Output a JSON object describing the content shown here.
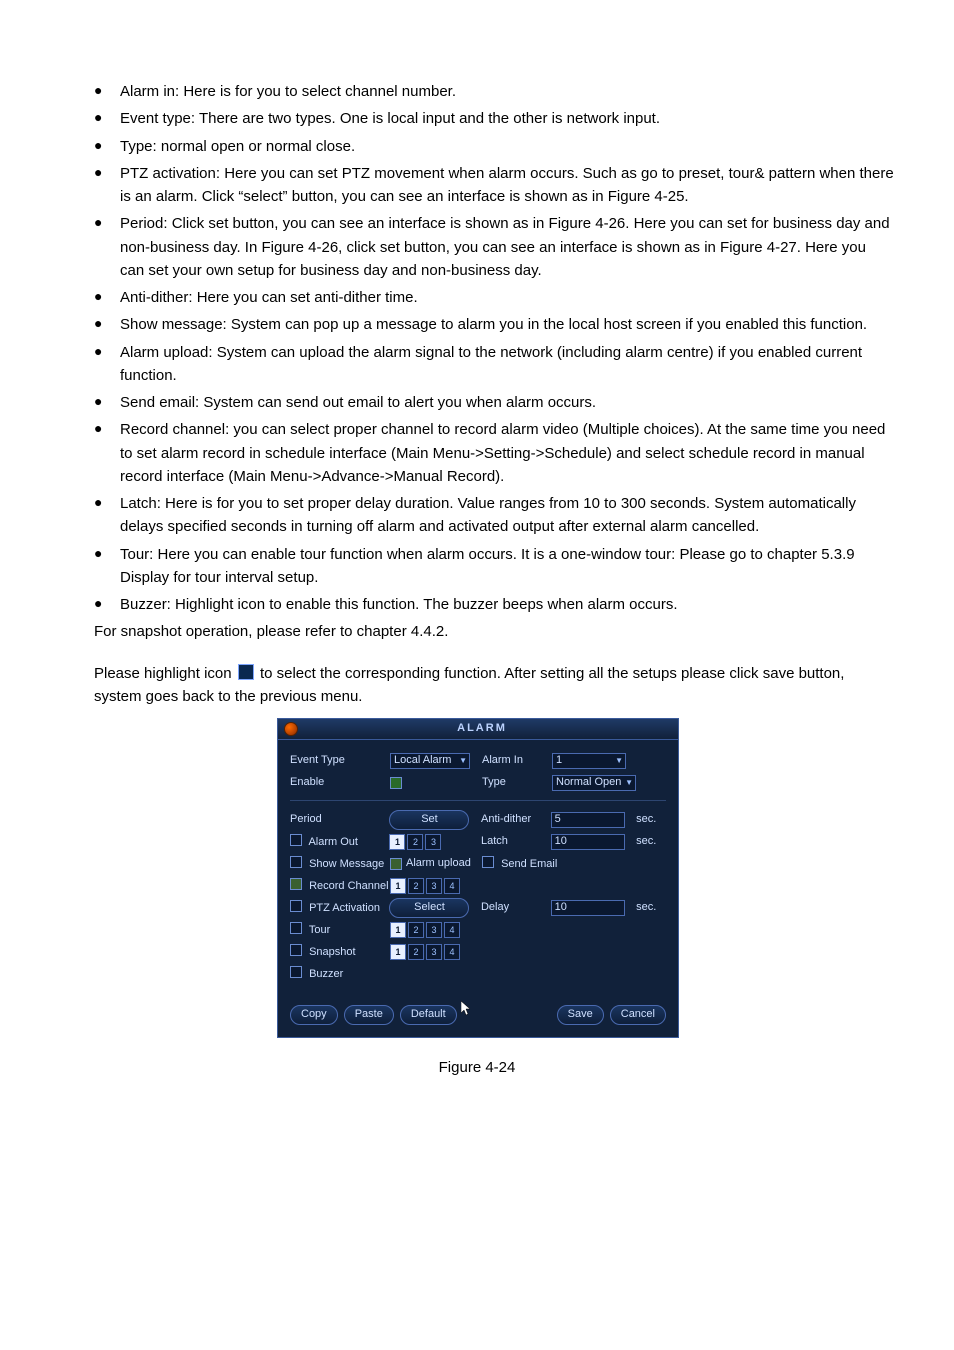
{
  "bullets": [
    "Alarm in: Here is for you to select channel number.",
    "Event type: There are two types. One is local input and the other is network input.",
    "Type: normal open or normal close.",
    "PTZ activation: Here you can set PTZ movement when alarm occurs. Such as go to preset, tour& pattern when there is an alarm. Click “select” button, you can see an interface is shown as in Figure 4-25.",
    "Period: Click set button, you can see an interface is shown as in Figure 4-26. Here you can set for business day and non-business day. In Figure 4-26, click set button, you can see an interface is shown as in Figure 4-27. Here you can set your own setup for business day and non-business day.",
    "Anti-dither: Here you can set anti-dither time.",
    "Show message: System can pop up a message to alarm you in the local host screen if you enabled this function.",
    "Alarm upload: System can upload the alarm signal to the network (including alarm centre) if you enabled current function.",
    "Send email: System can send out email to alert you when alarm occurs.",
    "Record channel: you can select proper channel to record alarm video (Multiple choices). At the same time you need to set alarm record in schedule interface (Main Menu->Setting->Schedule) and select schedule record in manual record interface (Main Menu->Advance->Manual Record).",
    "Latch: Here is for you to set proper delay duration. Value ranges from 10 to 300 seconds. System automatically delays specified seconds in turning off alarm and activated output after external alarm cancelled.",
    "Tour: Here you can enable tour function when alarm occurs.  It is a one-window tour: Please go to chapter 5.3.9 Display for tour interval setup.",
    "Buzzer: Highlight icon to enable this function. The buzzer beeps when alarm occurs."
  ],
  "post_bullets_line": "For snapshot operation, please refer to chapter 4.4.2.",
  "icon_paragraph_before": "Please highlight icon ",
  "icon_paragraph_after": " to select the corresponding function. After setting all the setups please click save button, system goes back to the previous menu.",
  "figure_caption": "Figure 4-24",
  "dvr": {
    "title": "ALARM",
    "labels": {
      "event_type": "Event Type",
      "enable": "Enable",
      "alarm_in": "Alarm In",
      "type": "Type",
      "period": "Period",
      "anti_dither": "Anti-dither",
      "alarm_out": "Alarm Out",
      "latch": "Latch",
      "show_msg": "Show Message",
      "alarm_upload": "Alarm upload",
      "send_email": "Send Email",
      "record_ch": "Record Channel",
      "ptz": "PTZ Activation",
      "delay": "Delay",
      "tour": "Tour",
      "snapshot": "Snapshot",
      "buzzer": "Buzzer",
      "sec": "sec."
    },
    "values": {
      "event_type": "Local Alarm",
      "alarm_in": "1",
      "type": "Normal Open",
      "anti_dither": "5",
      "latch": "10",
      "delay": "10"
    },
    "buttons": {
      "set": "Set",
      "select": "Select",
      "copy": "Copy",
      "paste": "Paste",
      "default": "Default",
      "save": "Save",
      "cancel": "Cancel"
    },
    "alarm_out_channels": [
      {
        "n": "1",
        "sel": true
      },
      {
        "n": "2",
        "sel": false
      },
      {
        "n": "3",
        "sel": false
      }
    ],
    "record_channels": [
      {
        "n": "1",
        "sel": true
      },
      {
        "n": "2",
        "sel": false
      },
      {
        "n": "3",
        "sel": false
      },
      {
        "n": "4",
        "sel": false
      }
    ],
    "tour_channels": [
      {
        "n": "1",
        "sel": true
      },
      {
        "n": "2",
        "sel": false
      },
      {
        "n": "3",
        "sel": false
      },
      {
        "n": "4",
        "sel": false
      }
    ],
    "snapshot_channels": [
      {
        "n": "1",
        "sel": true
      },
      {
        "n": "2",
        "sel": false
      },
      {
        "n": "3",
        "sel": false
      },
      {
        "n": "4",
        "sel": false
      }
    ]
  }
}
